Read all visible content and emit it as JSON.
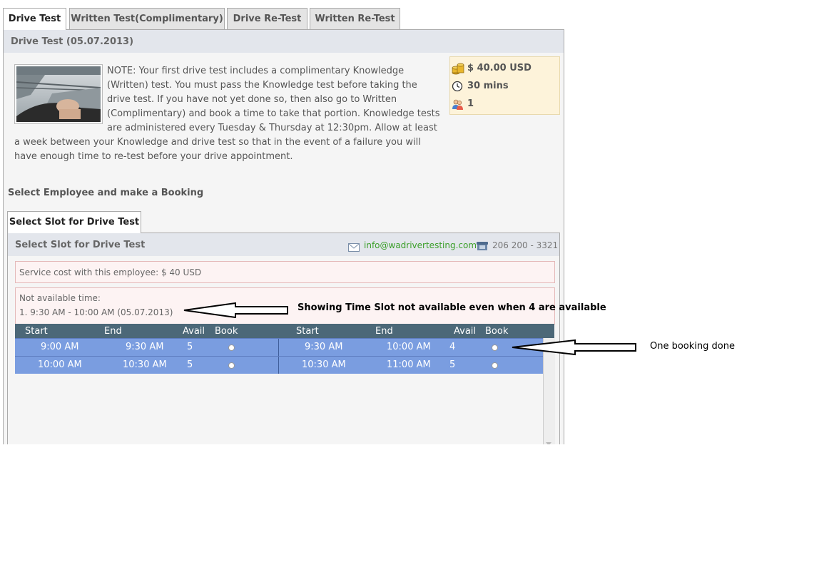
{
  "tabs": [
    "Drive Test",
    "Written Test(Complimentary)",
    "Drive Re-Test",
    "Written Re-Test"
  ],
  "panel_title": "Drive Test (05.07.2013)",
  "note": "NOTE: Your first drive test includes a complimentary Knowledge (Written) test. You must pass the Knowledge test before taking the drive test. If you have not yet done so, then also go to Written (Complimentary) and book a time to take that portion. Knowledge tests are administered every Tuesday & Thursday at 12:30pm. Allow at least a week between your Knowledge and drive test so that in the event of a failure you will have enough time to re-test before your drive appointment.",
  "info": {
    "price": "$ 40.00 USD",
    "duration": "30 mins",
    "capacity": "1"
  },
  "select_employee": "Select Employee and make a Booking",
  "subtab": "Select Slot for Drive Test",
  "subpanel_title": "Select Slot for Drive Test",
  "email": "info@wadrivertesting.com",
  "phone": "206 200 - 3321",
  "service_cost": "Service cost with this employee: $ 40 USD",
  "not_available_label": "Not available time:",
  "not_available_item": "1. 9:30 AM - 10:00 AM (05.07.2013)",
  "table_headers": [
    "Start",
    "End",
    "Avail",
    "Book",
    "Start",
    "End",
    "Avail",
    "Book"
  ],
  "rows": [
    {
      "left": {
        "start": "9:00 AM",
        "end": "9:30 AM",
        "avail": "5"
      },
      "right": {
        "start": "9:30 AM",
        "end": "10:00 AM",
        "avail": "4"
      }
    },
    {
      "left": {
        "start": "10:00 AM",
        "end": "10:30 AM",
        "avail": "5"
      },
      "right": {
        "start": "10:30 AM",
        "end": "11:00 AM",
        "avail": "5"
      }
    }
  ],
  "annotations": {
    "not_available": "Showing Time Slot not available even when 4 are available",
    "one_booking": "One booking done"
  },
  "colors": {
    "header_row": "#4c6878",
    "slot_row": "#7a9de0",
    "email": "#3b9f2a",
    "info_bg": "#fdf3da"
  }
}
